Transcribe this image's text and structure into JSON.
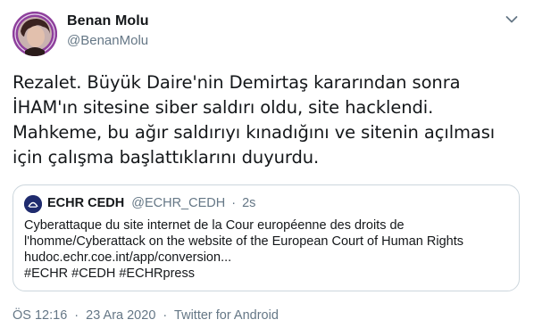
{
  "author": {
    "name": "Benan Molu",
    "handle": "@BenanMolu"
  },
  "icons": {
    "menu": "chevron-down-icon",
    "avatar": "profile-photo",
    "quote_avatar": "echr-logo"
  },
  "tweet": {
    "lines": [
      "Rezalet. Büyük Daire'nin Demirtaş kararından sonra",
      "İHAM'ın sitesine siber saldırı oldu, site hacklendi.",
      "Mahkeme, bu ağır saldırıyı kınadığını ve sitenin açılması",
      "için çalışma başlattıklarını duyurdu."
    ]
  },
  "quote": {
    "name": "ECHR CEDH",
    "handle": "@ECHR_CEDH",
    "separator": "·",
    "time": "2s",
    "lines": [
      "Cyberattaque du site internet de la Cour européenne des droits de",
      "l'homme/Cyberattack on the website of the European Court of Human Rights",
      "hudoc.echr.coe.int/app/conversion...",
      "#ECHR #CEDH #ECHRpress"
    ]
  },
  "meta": {
    "time": "ÖS 12:16",
    "date": "23 Ara 2020",
    "source": "Twitter for Android",
    "separator": "·"
  },
  "colors": {
    "text": "#14171a",
    "secondary": "#657786",
    "border": "#ccd6dd"
  }
}
